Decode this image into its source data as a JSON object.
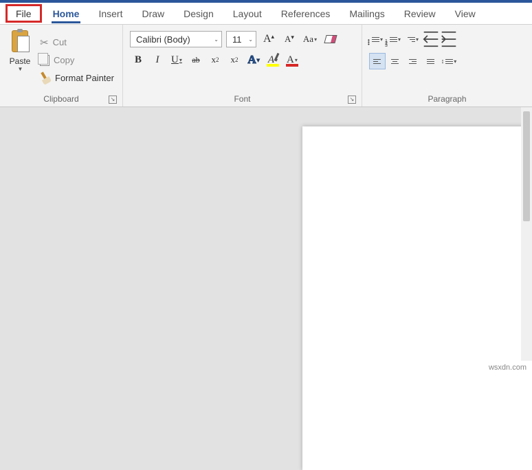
{
  "tabs": {
    "file": "File",
    "home": "Home",
    "insert": "Insert",
    "draw": "Draw",
    "design": "Design",
    "layout": "Layout",
    "references": "References",
    "mailings": "Mailings",
    "review": "Review",
    "view": "View"
  },
  "clipboard": {
    "paste": "Paste",
    "cut": "Cut",
    "copy": "Copy",
    "format_painter": "Format Painter",
    "group_label": "Clipboard"
  },
  "font": {
    "name": "Calibri (Body)",
    "size": "11",
    "grow": "A",
    "shrink": "A",
    "case": "Aa",
    "bold": "B",
    "italic": "I",
    "underline": "U",
    "strike": "ab",
    "sub": "x",
    "sup": "x",
    "fxA": "A",
    "hlA": "A",
    "fcA": "A",
    "group_label": "Font"
  },
  "paragraph": {
    "group_label": "Paragraph"
  },
  "watermark": "wsxdn.com"
}
